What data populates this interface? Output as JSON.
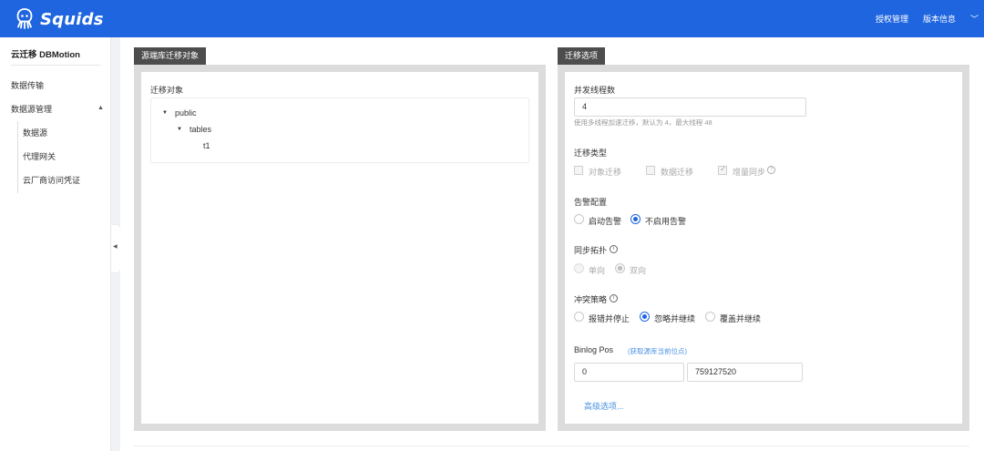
{
  "header": {
    "brand": "Squids",
    "nav": [
      "授权管理",
      "版本信息"
    ],
    "chevron_icon": "chevron-down-icon"
  },
  "sidebar": {
    "title": "云迁移 DBMotion",
    "items": [
      "数据传输",
      "数据源管理"
    ],
    "sub_items": [
      "数据源",
      "代理网关",
      "云厂商访问凭证"
    ]
  },
  "source_panel": {
    "tag": "源端库迁移对象",
    "label": "迁移对象",
    "tree": {
      "root": "public",
      "child": "tables",
      "leaf": "t1"
    }
  },
  "options_panel": {
    "tag": "迁移选项",
    "threads": {
      "label": "并发线程数",
      "value": "4",
      "hint": "使用多线程加速迁移，默认为 4，最大线程 48"
    },
    "migration_type": {
      "label": "迁移类型",
      "options": [
        {
          "label": "对象迁移",
          "checked": false
        },
        {
          "label": "数据迁移",
          "checked": false
        },
        {
          "label": "增量同步",
          "checked": true
        }
      ]
    },
    "alert": {
      "label": "告警配置",
      "options": [
        "启动告警",
        "不启用告警"
      ],
      "selected": 1
    },
    "topology": {
      "label": "同步拓扑",
      "options": [
        "单向",
        "双向"
      ],
      "selected": 1
    },
    "conflict": {
      "label": "冲突策略",
      "options": [
        "报错并停止",
        "忽略并继续",
        "覆盖并继续"
      ],
      "selected": 1
    },
    "binlog": {
      "label": "Binlog Pos",
      "link": "(获取源库当前位点)",
      "file": "0",
      "pos": "759127520"
    },
    "advanced": "高级选项..."
  },
  "colors": {
    "brand": "#1f65e0",
    "panel_tag": "#4d4d4d",
    "link": "#4a90e2"
  }
}
